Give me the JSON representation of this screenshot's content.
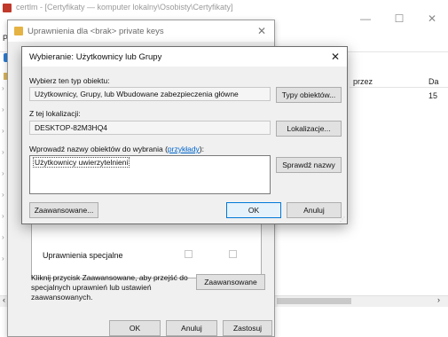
{
  "background_window": {
    "title": "certlm - [Certyfikaty — komputer lokalny\\Osobisty\\Certyfikaty]",
    "menu_letter": "P",
    "columns": [
      "przez",
      "Da"
    ],
    "cells": [
      "15"
    ],
    "controls": {
      "minimize": "—",
      "maximize": "☐",
      "close": "✕"
    },
    "scroll_left": "‹",
    "scroll_right": "›"
  },
  "permissions_dialog": {
    "title": "Uprawnienia dla <brak> private keys",
    "close": "✕",
    "special_permissions": "Uprawnienia specjalne",
    "info_text": "Kliknij przycisk Zaawansowane, aby przejść do specjalnych uprawnień lub ustawień zaawansowanych.",
    "advanced_button": "Zaawansowane",
    "ok_button": "OK",
    "cancel_button": "Anuluj",
    "apply_button": "Zastosuj"
  },
  "select_dialog": {
    "title": "Wybieranie: Użytkownicy lub Grupy",
    "close": "✕",
    "object_type_label": "Wybierz ten typ obiektu:",
    "object_type_value": "Użytkownicy, Grupy, lub Wbudowane zabezpieczenia główne",
    "object_types_button": "Typy obiektów...",
    "location_label": "Z tej lokalizacji:",
    "location_value": "DESKTOP-82M3HQ4",
    "locations_button": "Lokalizacje...",
    "names_label_prefix": "Wprowadź nazwy obiektów do wybrania (",
    "names_label_link": "przykłady",
    "names_label_suffix": "):",
    "names_value": "Użytkownicy uwierzytelnieni",
    "check_names_button": "Sprawdź nazwy",
    "advanced_button": "Zaawansowane...",
    "ok_button": "OK",
    "cancel_button": "Anuluj"
  }
}
